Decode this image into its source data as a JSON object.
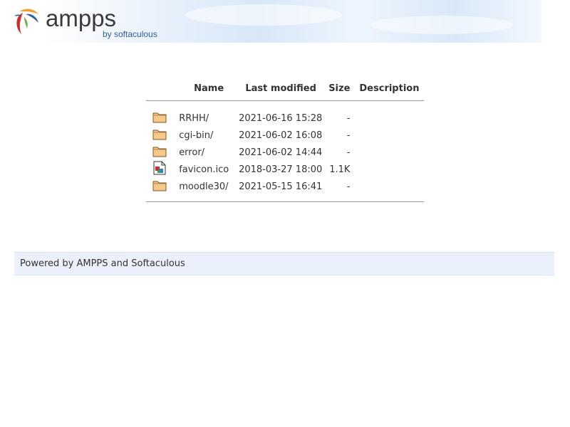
{
  "header": {
    "logo_word": "ampps",
    "logo_sub": "by softaculous"
  },
  "listing": {
    "columns": {
      "name": "Name",
      "last_modified": "Last modified",
      "size": "Size",
      "description": "Description"
    },
    "rows": [
      {
        "icon": "folder-icon",
        "name": "RRHH/",
        "modified": "2021-06-16 15:28",
        "size": "-",
        "description": ""
      },
      {
        "icon": "folder-icon",
        "name": "cgi-bin/",
        "modified": "2021-06-02 16:08",
        "size": "-",
        "description": ""
      },
      {
        "icon": "folder-icon",
        "name": "error/",
        "modified": "2021-06-02 14:44",
        "size": "-",
        "description": ""
      },
      {
        "icon": "image-file-icon",
        "name": "favicon.ico",
        "modified": "2018-03-27 18:00",
        "size": "1.1K",
        "description": ""
      },
      {
        "icon": "folder-icon",
        "name": "moodle30/",
        "modified": "2021-05-15 16:41",
        "size": "-",
        "description": ""
      }
    ]
  },
  "footer": {
    "text": "Powered by AMPPS and Softaculous"
  },
  "colors": {
    "folder": "#f5c98a",
    "logo_red": "#c9302c",
    "logo_blue": "#2a5f9e",
    "logo_green": "#6ab04c",
    "logo_orange": "#f0a030"
  }
}
